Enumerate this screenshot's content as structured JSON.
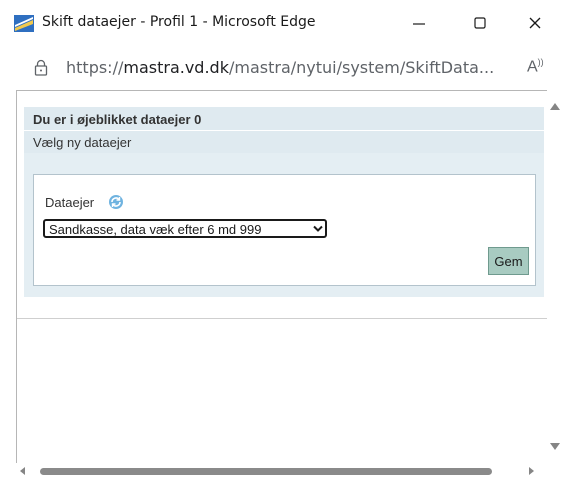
{
  "window": {
    "title": "Skift dataejer - Profil 1 - Microsoft Edge",
    "minimize_glyph": "—",
    "close_glyph": "✕"
  },
  "address": {
    "url_prefix": "https://",
    "url_domain": "mastra.vd.dk",
    "url_path": "/mastra/nytui/system/SkiftData...",
    "read_aloud": "A))"
  },
  "page": {
    "heading": "Du er i øjeblikket dataejer 0",
    "subheading": "Vælg ny dataejer",
    "field_label": "Dataejer",
    "select_value": "Sandkasse, data væk efter 6 md 999",
    "save_label": "Gem"
  },
  "colors": {
    "panel_bg": "#e4eef3",
    "save_button_bg": "#a8cbc1"
  }
}
